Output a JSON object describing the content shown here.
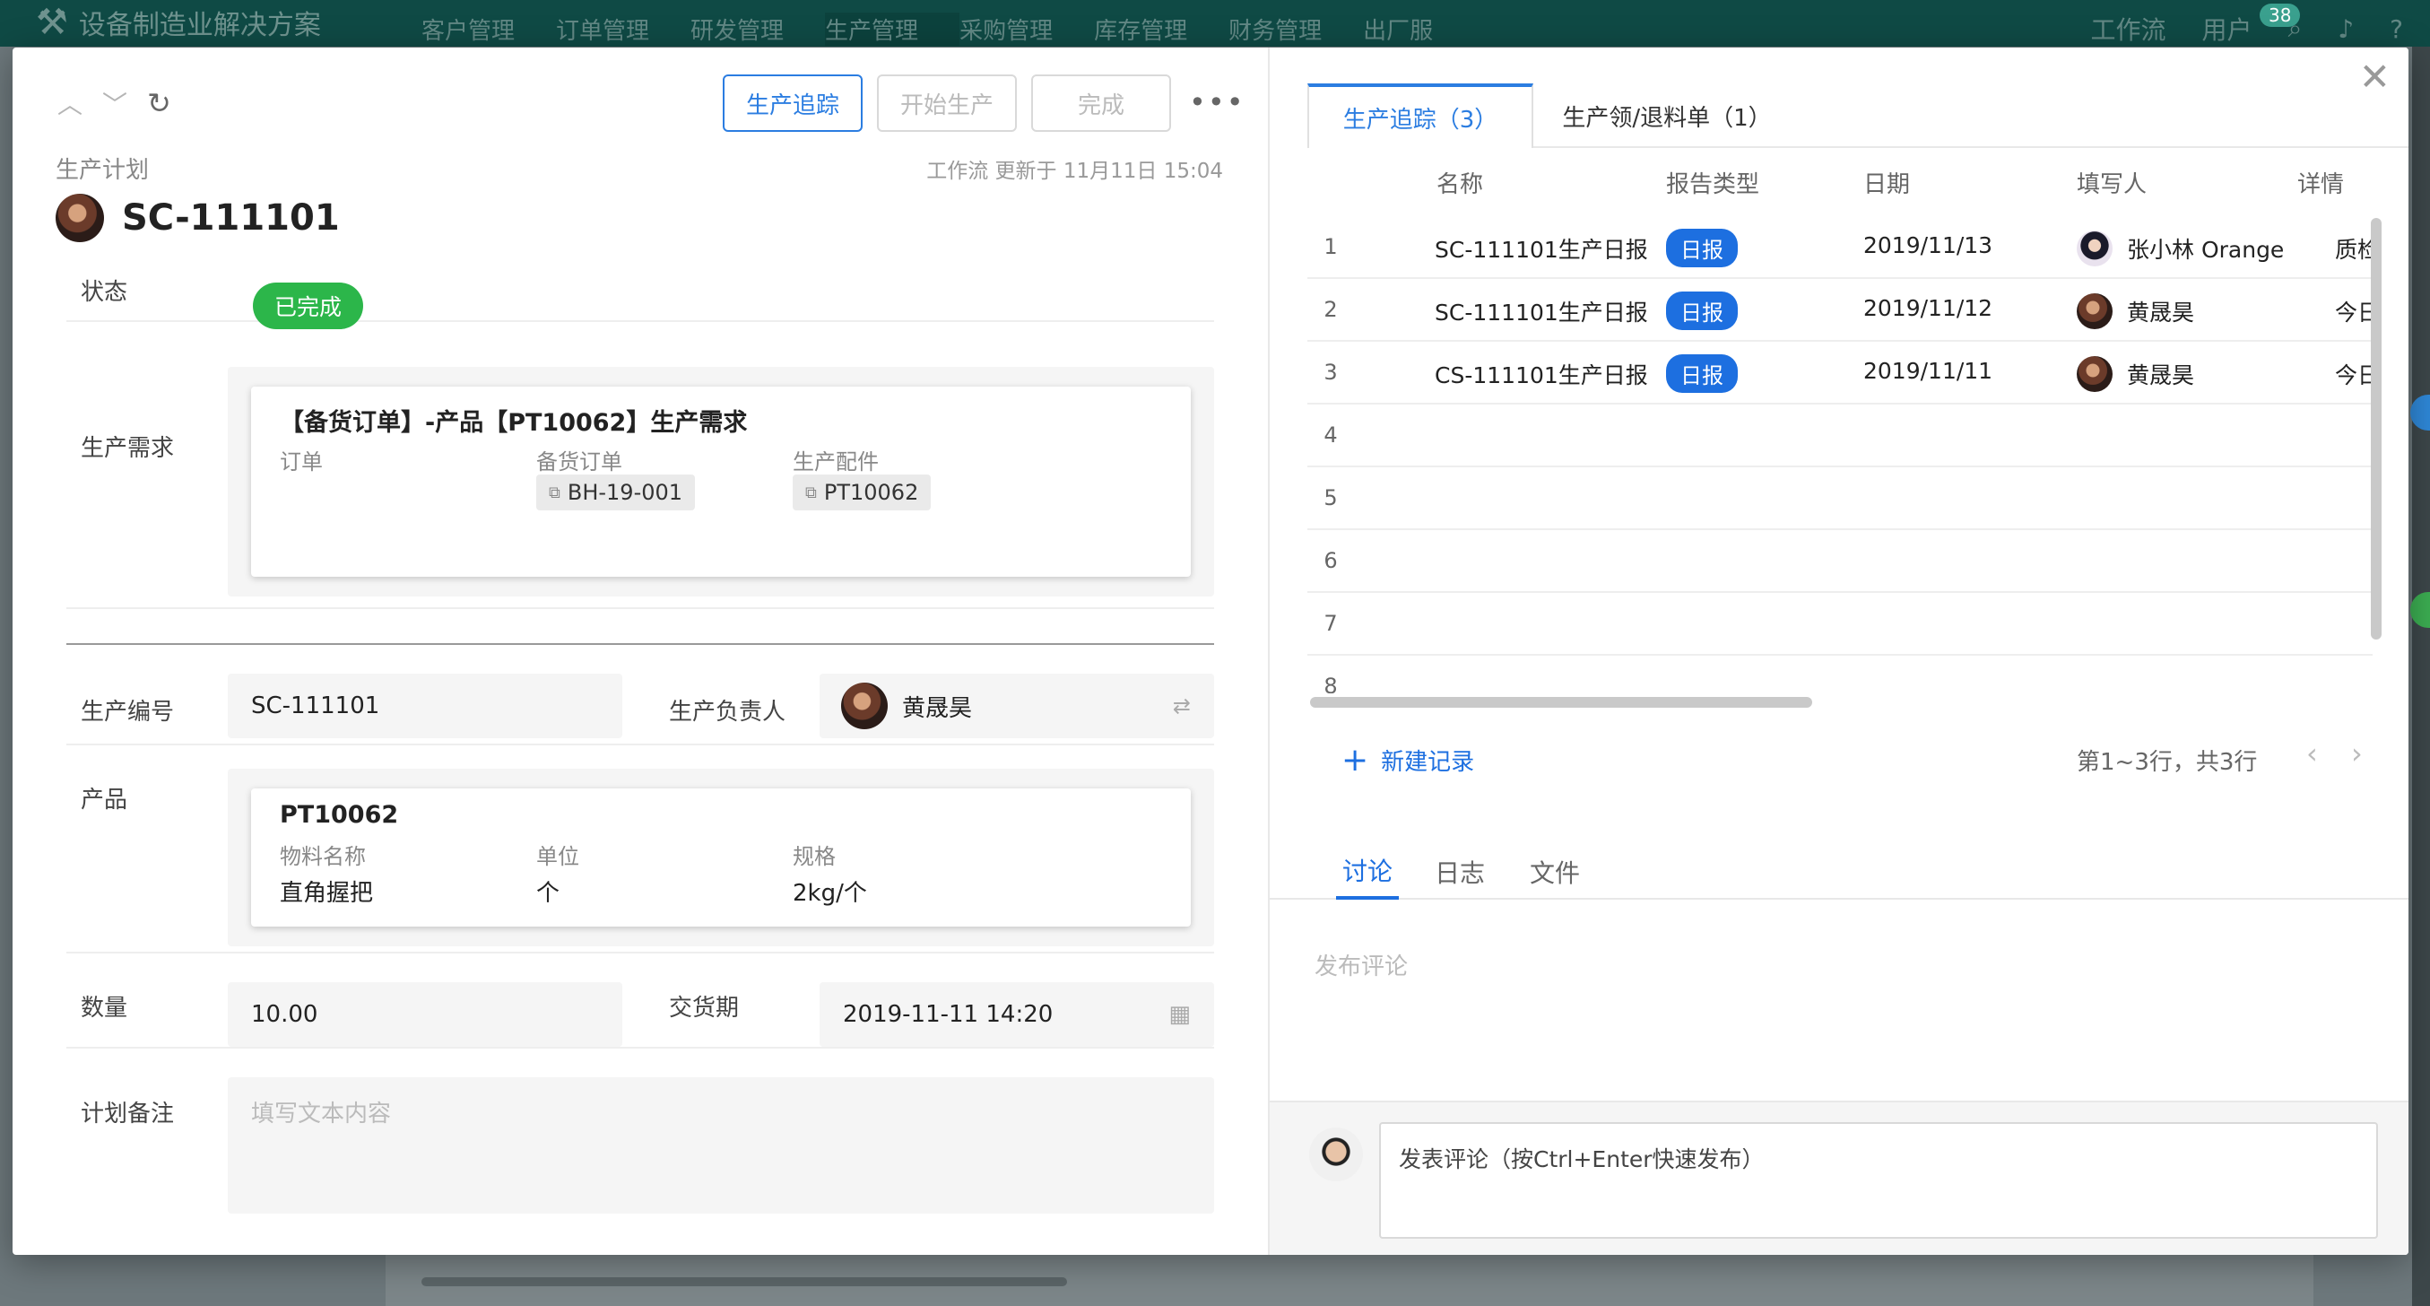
{
  "app": {
    "brand": "设备制造业解决方案",
    "nav": [
      "客户管理",
      "订单管理",
      "研发管理",
      "生产管理",
      "采购管理",
      "库存管理",
      "财务管理",
      "出厂服"
    ],
    "right": [
      "工作流",
      "用户"
    ],
    "notif_count": "38"
  },
  "toolbar": {
    "track_label": "生产追踪",
    "start_label": "开始生产",
    "finish_label": "完成"
  },
  "record": {
    "breadcrumb": "生产计划",
    "updated": "工作流 更新于 11月11日 15:04",
    "title": "SC-111101"
  },
  "fields": {
    "status_label": "状态",
    "status_value": "已完成",
    "demand_label": "生产需求",
    "demand": {
      "title": "【备货订单】-产品【PT10062】生产需求",
      "col1": "订单",
      "col2": "备货订单",
      "col3": "生产配件",
      "tag2": "BH-19-001",
      "tag3": "PT10062"
    },
    "code_label": "生产编号",
    "code_value": "SC-111101",
    "owner_label": "生产负责人",
    "owner_value": "黄晟昊",
    "product_label": "产品",
    "product": {
      "title": "PT10062",
      "col1": "物料名称",
      "col2": "单位",
      "col3": "规格",
      "val1": "直角握把",
      "val2": "个",
      "val3": "2kg/个"
    },
    "qty_label": "数量",
    "qty_value": "10.00",
    "delivery_label": "交货期",
    "delivery_value": "2019-11-11 14:20",
    "note_label": "计划备注",
    "note_placeholder": "填写文本内容"
  },
  "right": {
    "tab1": "生产追踪（3）",
    "tab2": "生产领/退料单（1）",
    "headers": [
      "名称",
      "报告类型",
      "日期",
      "填写人",
      "详情"
    ],
    "rows": [
      {
        "n": "1",
        "name": "SC-111101生产日报",
        "type": "日报",
        "date": "2019/11/13",
        "user": "张小林 Orange",
        "detail": "质检完成"
      },
      {
        "n": "2",
        "name": "SC-111101生产日报",
        "type": "日报",
        "date": "2019/11/12",
        "user": "黄晟昊",
        "detail": "今日完成"
      },
      {
        "n": "3",
        "name": "CS-111101生产日报",
        "type": "日报",
        "date": "2019/11/11",
        "user": "黄晟昊",
        "detail": "今日生产"
      },
      {
        "n": "4"
      },
      {
        "n": "5"
      },
      {
        "n": "6"
      },
      {
        "n": "7"
      },
      {
        "n": "8"
      }
    ],
    "new_record": "新建记录",
    "pager": "第1~3行，共3行",
    "subtabs": [
      "讨论",
      "日志",
      "文件"
    ],
    "comment_placeholder": "发布评论",
    "comment_box": "发表评论（按Ctrl+Enter快速发布）"
  }
}
